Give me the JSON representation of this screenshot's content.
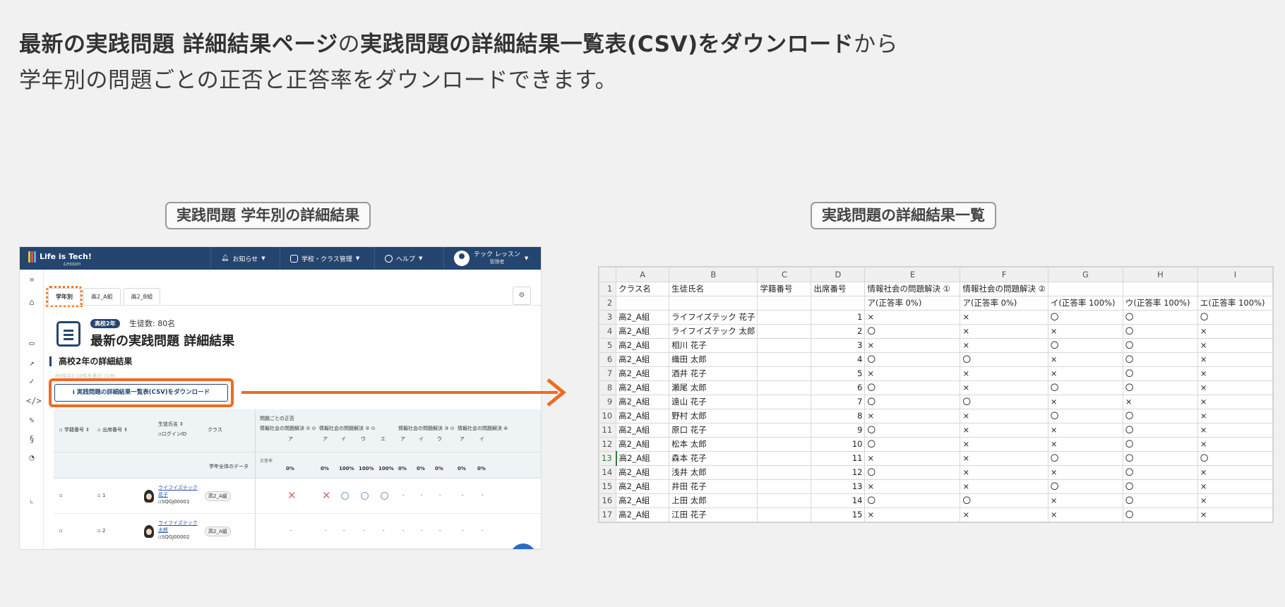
{
  "headline": {
    "line1_bold_a": "最新の実践問題 詳細結果ページ",
    "line1_mid": "の",
    "line1_bold_b": "実践問題の詳細結果一覧表(CSV)をダウンロード",
    "line1_end": "から",
    "line2": "学年別の問題ごとの正否と正答率をダウンロードできます。"
  },
  "captions": {
    "left": "実践問題 学年別の詳細結果",
    "right": "実践問題の詳細結果一覧"
  },
  "colors": {
    "accent_orange": "#ee6b21",
    "navy": "#24456f",
    "green_cursor": "#2e7d32"
  },
  "app": {
    "logo": "Life is Tech!",
    "logo_sub": "Lesson",
    "nav": {
      "notice": "お知らせ",
      "school": "学校・クラス管理",
      "help": "ヘルプ"
    },
    "user": {
      "name": "テック レッスン",
      "role": "管理者"
    },
    "sidebar_icons": [
      "chevrons-right-icon",
      "home-icon",
      "monitor-icon",
      "trend-icon",
      "check-circle-icon",
      "code-icon",
      "pencil-icon",
      "python-icon",
      "palette-icon",
      "chart-icon"
    ],
    "tabs": [
      "学年別",
      "高2_A組",
      "高2_B組"
    ],
    "grade_badge": "高校2年",
    "student_count": "生徒数: 80名",
    "page_title": "最新の実践問題 詳細結果",
    "section_title": "高校2年の詳細結果",
    "faint_text": "80件中1-10件を表示 (1/8)",
    "download_button": "実践問題の詳細結果一覧表(CSV)をダウンロード",
    "grid": {
      "headers": {
        "gakuseki": "学籍番号",
        "shusseki": "出席番号",
        "name": "生徒氏名",
        "login": "ログインID",
        "class": "クラス",
        "per_q": "問題ごとの正否"
      },
      "groups": [
        "情報社会の問題解決 ①",
        "情報社会の問題解決 ②",
        "情報社会の問題解決 ③",
        "情報社会の問題解決 ④"
      ],
      "choices": [
        "ア",
        "ア",
        "イ",
        "ウ",
        "エ",
        "ア",
        "イ",
        "ウ",
        "ア",
        "イ"
      ],
      "avg_label": "学年全体のデータ",
      "rate_label": "正答率",
      "rates": [
        "0%",
        "0%",
        "100%",
        "100%",
        "100%",
        "0%",
        "0%",
        "0%",
        "0%",
        "0%"
      ],
      "rows": [
        {
          "no": "1",
          "name_a": "ライフイズテック",
          "name_b": "花子",
          "login": "SQGJ00001",
          "cls": "高2_A組"
        },
        {
          "no": "2",
          "name_a": "ライフイズテック",
          "name_b": "太郎",
          "login": "SQGJ00002",
          "cls": "高2_A組"
        }
      ],
      "dash": "-"
    }
  },
  "sheet": {
    "columns": [
      "A",
      "B",
      "C",
      "D",
      "E",
      "F",
      "G",
      "H",
      "I"
    ],
    "row1": [
      "クラス名",
      "生徒氏名",
      "学籍番号",
      "出席番号",
      "情報社会の問題解決 ①",
      "情報社会の問題解決 ②",
      "",
      "",
      ""
    ],
    "row2": [
      "",
      "",
      "",
      "",
      "ア(正答率 0%)",
      "ア(正答率 0%)",
      "イ(正答率 100%)",
      "ウ(正答率 100%)",
      "エ(正答率 100%)"
    ],
    "data": [
      [
        "高2_A組",
        "ライフイズテック 花子",
        "",
        "1",
        "×",
        "×",
        "〇",
        "〇",
        "〇"
      ],
      [
        "高2_A組",
        "ライフイズテック 太郎",
        "",
        "2",
        "〇",
        "×",
        "×",
        "〇",
        "×"
      ],
      [
        "高2_A組",
        "相川 花子",
        "",
        "3",
        "×",
        "×",
        "〇",
        "〇",
        "×"
      ],
      [
        "高2_A組",
        "織田 太郎",
        "",
        "4",
        "〇",
        "〇",
        "×",
        "〇",
        "×"
      ],
      [
        "高2_A組",
        "酒井 花子",
        "",
        "5",
        "×",
        "×",
        "×",
        "〇",
        "×"
      ],
      [
        "高2_A組",
        "瀬尾 太郎",
        "",
        "6",
        "〇",
        "×",
        "〇",
        "〇",
        "×"
      ],
      [
        "高2_A組",
        "遠山 花子",
        "",
        "7",
        "〇",
        "〇",
        "×",
        "×",
        "×"
      ],
      [
        "高2_A組",
        "野村 太郎",
        "",
        "8",
        "×",
        "×",
        "〇",
        "〇",
        "×"
      ],
      [
        "高2_A組",
        "原口 花子",
        "",
        "9",
        "〇",
        "×",
        "×",
        "〇",
        "×"
      ],
      [
        "高2_A組",
        "松本 太郎",
        "",
        "10",
        "〇",
        "×",
        "×",
        "〇",
        "×"
      ],
      [
        "高2_A組",
        "森本 花子",
        "",
        "11",
        "×",
        "×",
        "〇",
        "〇",
        "〇"
      ],
      [
        "高2_A組",
        "浅井 太郎",
        "",
        "12",
        "〇",
        "×",
        "×",
        "〇",
        "×"
      ],
      [
        "高2_A組",
        "井田 花子",
        "",
        "13",
        "×",
        "×",
        "〇",
        "〇",
        "×"
      ],
      [
        "高2_A組",
        "上田 太郎",
        "",
        "14",
        "〇",
        "〇",
        "×",
        "〇",
        "×"
      ],
      [
        "高2_A組",
        "江田 花子",
        "",
        "15",
        "×",
        "×",
        "×",
        "〇",
        "×"
      ]
    ]
  }
}
